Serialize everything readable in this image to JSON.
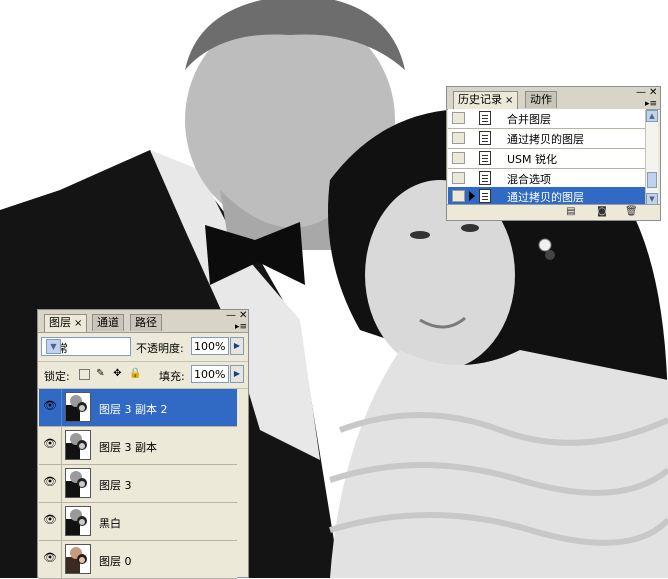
{
  "history_panel": {
    "tabs": [
      {
        "label": "历史记录",
        "close": "×"
      },
      {
        "label": "动作"
      }
    ],
    "items": [
      {
        "label": "合并图层",
        "selected": false
      },
      {
        "label": "通过拷贝的图层",
        "selected": false
      },
      {
        "label": "USM 锐化",
        "selected": false
      },
      {
        "label": "混合选项",
        "selected": false
      },
      {
        "label": "通过拷贝的图层",
        "selected": true
      }
    ]
  },
  "layers_panel": {
    "tabs": [
      {
        "label": "图层",
        "close": "×"
      },
      {
        "label": "通道"
      },
      {
        "label": "路径"
      }
    ],
    "blend_mode": "正常",
    "opacity_label": "不透明度:",
    "opacity_value": "100%",
    "lock_label": "锁定:",
    "fill_label": "填充:",
    "fill_value": "100%",
    "layers": [
      {
        "name": "图层 3 副本 2",
        "selected": true
      },
      {
        "name": "图层 3 副本",
        "selected": false
      },
      {
        "name": "图层 3",
        "selected": false
      },
      {
        "name": "黑白",
        "selected": false
      },
      {
        "name": "图层 0",
        "selected": false
      }
    ]
  },
  "colors": {
    "panel_bg": "#ece9d8",
    "selection": "#316ac5"
  }
}
